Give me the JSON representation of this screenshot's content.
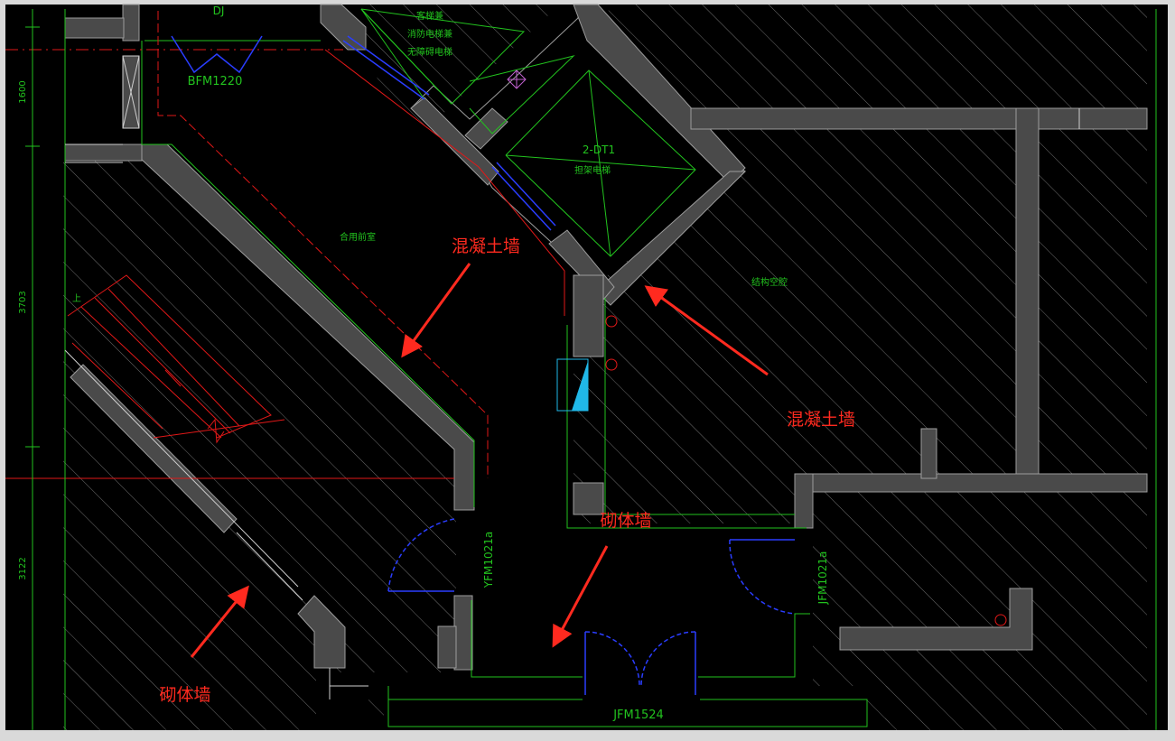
{
  "colors": {
    "background": "#000000",
    "frame": "#d9d9d9",
    "wall_fill": "#4a4a4a",
    "wall_edge": "#9c9c9c",
    "hatch": "#6f6f6f",
    "cad_green": "#22c21e",
    "cad_red": "#e01818",
    "cad_blue": "#2a3dff",
    "annotation_red": "#ff2a1f",
    "cyan": "#20b8e8"
  },
  "labels": {
    "dj": "DJ",
    "bfm1220": "BFM1220",
    "elevator_top_1": "客梯兼",
    "elevator_top_2": "消防电梯兼",
    "elevator_top_3": "无障碍电梯",
    "dt1": "2-DT1",
    "dt1_sub": "担架电梯",
    "shared_lobby": "合用前室",
    "structural_void": "结构空腔",
    "yfm1021": "YFM1021a",
    "jfm1021": "JFM1021a",
    "jfm1524": "JFM1524",
    "up": "上"
  },
  "dimensions": {
    "dim_1600": "1600",
    "dim_3703": "3703",
    "dim_3122": "3122"
  },
  "annotations": {
    "concrete_wall_1": "混凝土墙",
    "concrete_wall_2": "混凝土墙",
    "masonry_wall_1": "砌体墙",
    "masonry_wall_2": "砌体墙"
  }
}
